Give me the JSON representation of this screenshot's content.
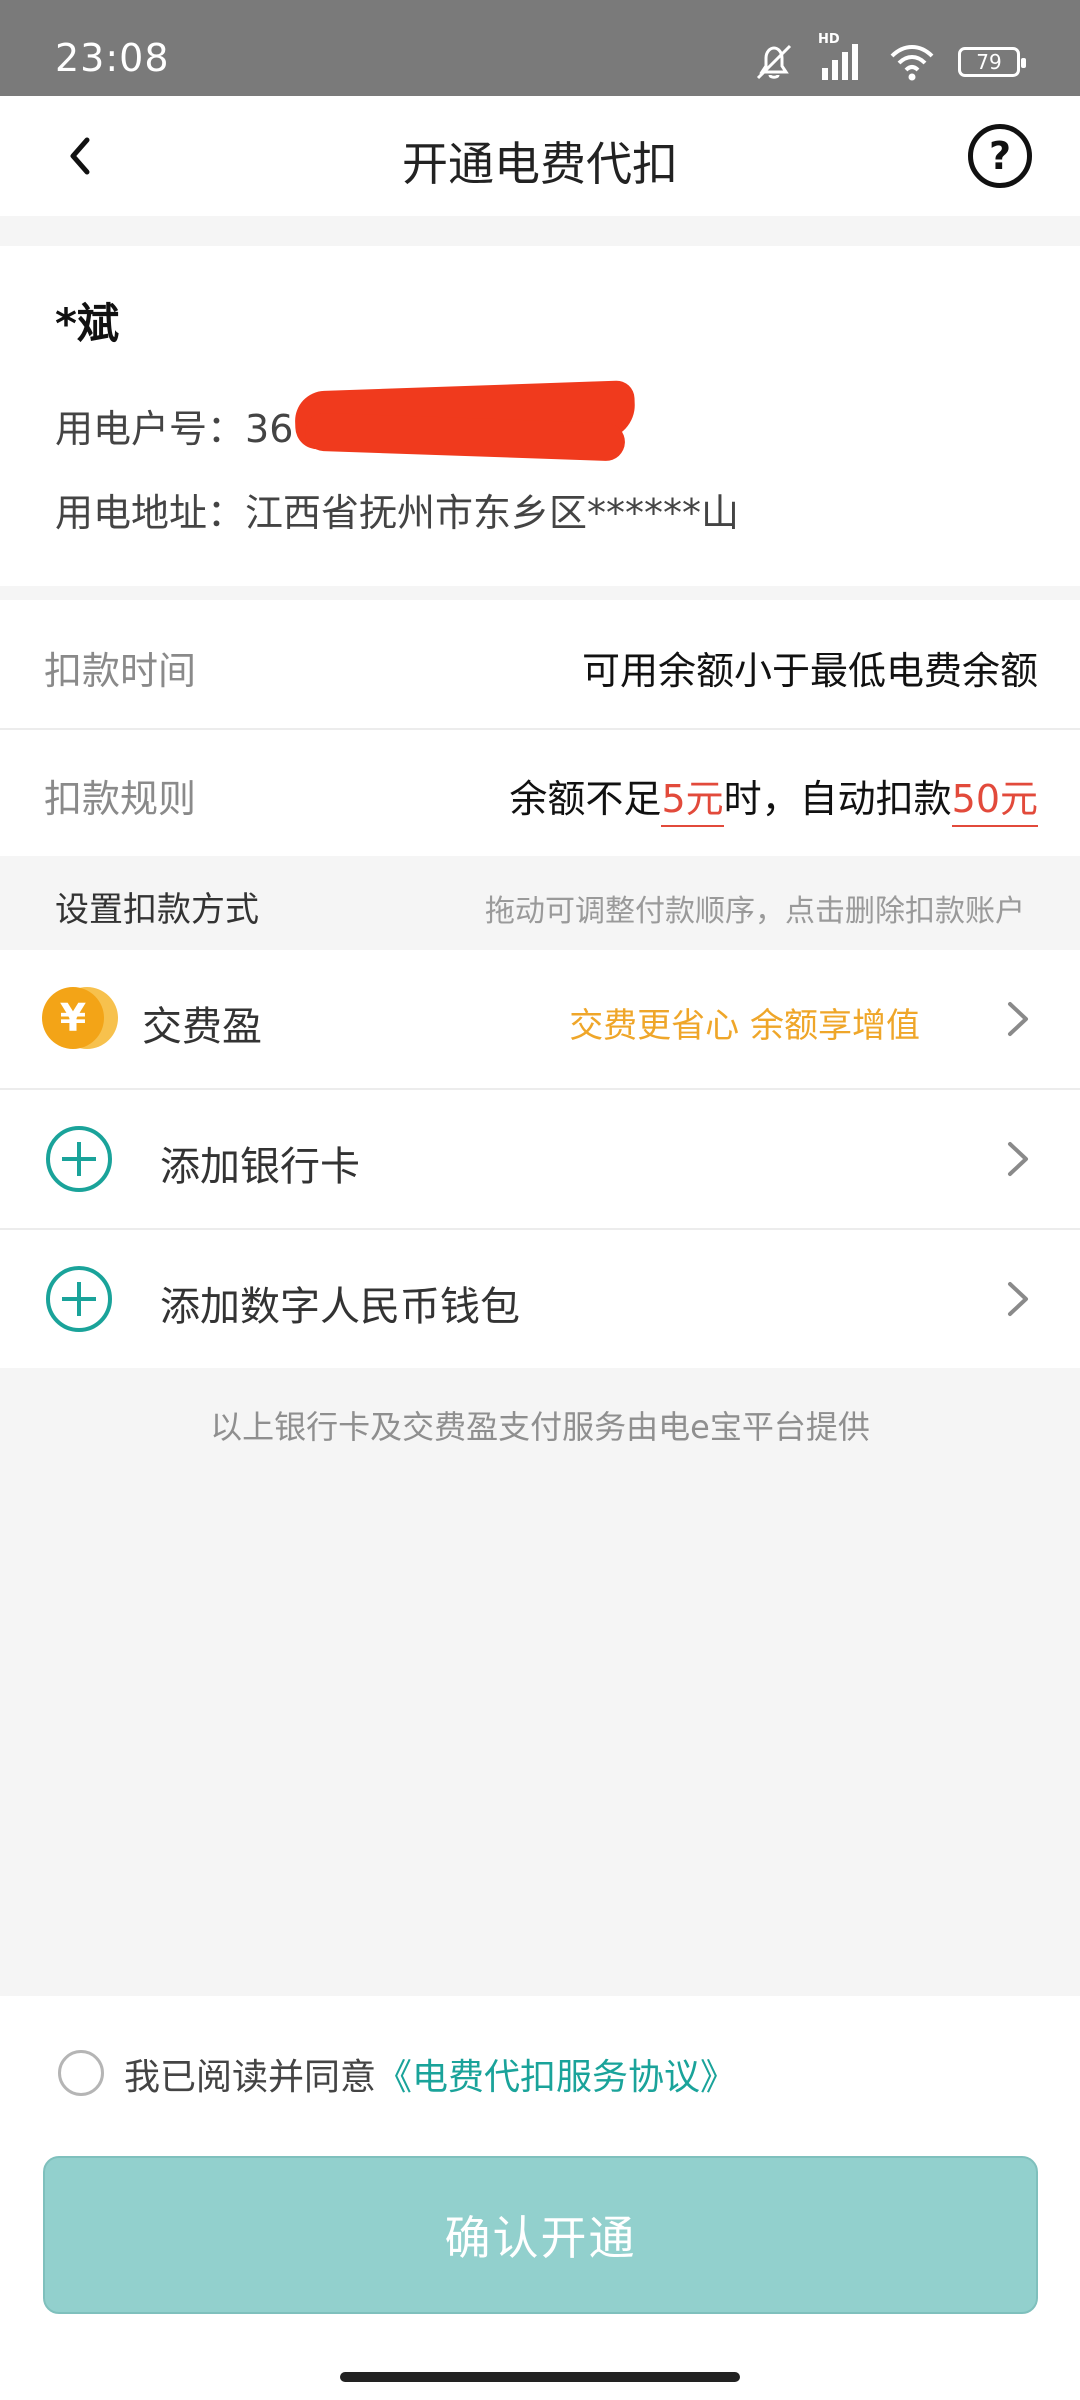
{
  "status_bar": {
    "time": "23:08",
    "hd_label": "HD",
    "battery_level": "79"
  },
  "navbar": {
    "title": "开通电费代扣",
    "back_icon": "chevron-left-icon",
    "help_icon": "question-circle-icon",
    "help_glyph": "?"
  },
  "user": {
    "name": "*斌",
    "account_label": "用电户号：",
    "account_visible": "36",
    "address_label": "用电地址：",
    "address_value": "江西省抚州市东乡区******山"
  },
  "deduction": {
    "time_label": "扣款时间",
    "time_value": "可用余额小于最低电费余额",
    "rule_label": "扣款规则",
    "rule_text_1": "余额不足",
    "rule_threshold": "5元",
    "rule_text_2": "时，自动扣款",
    "rule_amount": "50元"
  },
  "methods": {
    "title": "设置扣款方式",
    "hint": "拖动可调整付款顺序，点击删除扣款账户",
    "items": [
      {
        "label": "交费盈",
        "promo": "交费更省心 余额享增值",
        "icon": "yuan-coin-icon",
        "coin_glyph": "¥"
      },
      {
        "label": "添加银行卡",
        "icon": "plus-circle-icon"
      },
      {
        "label": "添加数字人民币钱包",
        "icon": "plus-circle-icon"
      }
    ]
  },
  "provider_note": "以上银行卡及交费盈支付服务由电e宝平台提供",
  "agreement": {
    "prefix": "我已阅读并同意",
    "link": "《电费代扣服务协议》"
  },
  "confirm_label": "确认开通",
  "colors": {
    "accent": "#1aa39a",
    "button": "#92d0cd",
    "warning_red": "#e24a3b",
    "promo_orange": "#efa629",
    "coin": "#f3a417",
    "status_bar": "#7a7a7a"
  }
}
